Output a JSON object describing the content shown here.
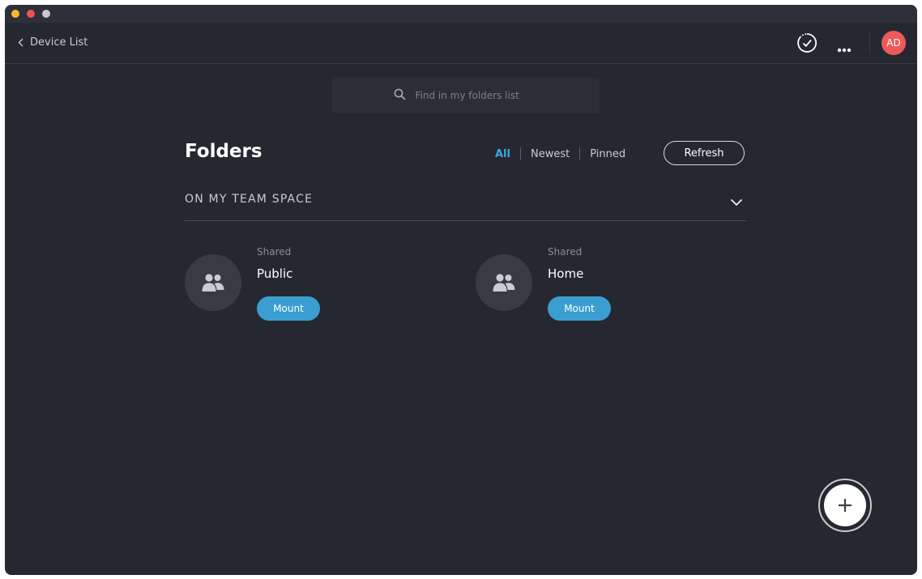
{
  "navbar": {
    "back_label": "Device List",
    "avatar_initials": "AD"
  },
  "search": {
    "placeholder": "Find in my folders list"
  },
  "folders": {
    "title": "Folders",
    "filters": [
      "All",
      "Newest",
      "Pinned"
    ],
    "active_filter": "All",
    "refresh_label": "Refresh"
  },
  "section": {
    "label": "ON MY TEAM SPACE"
  },
  "items": [
    {
      "type": "Shared",
      "name": "Public",
      "action": "Mount"
    },
    {
      "type": "Shared",
      "name": "Home",
      "action": "Mount"
    }
  ],
  "colors": {
    "accent": "#3aa8e0",
    "mount_button": "#3a9ed0",
    "avatar": "#ee5a5a",
    "background": "#252830"
  }
}
